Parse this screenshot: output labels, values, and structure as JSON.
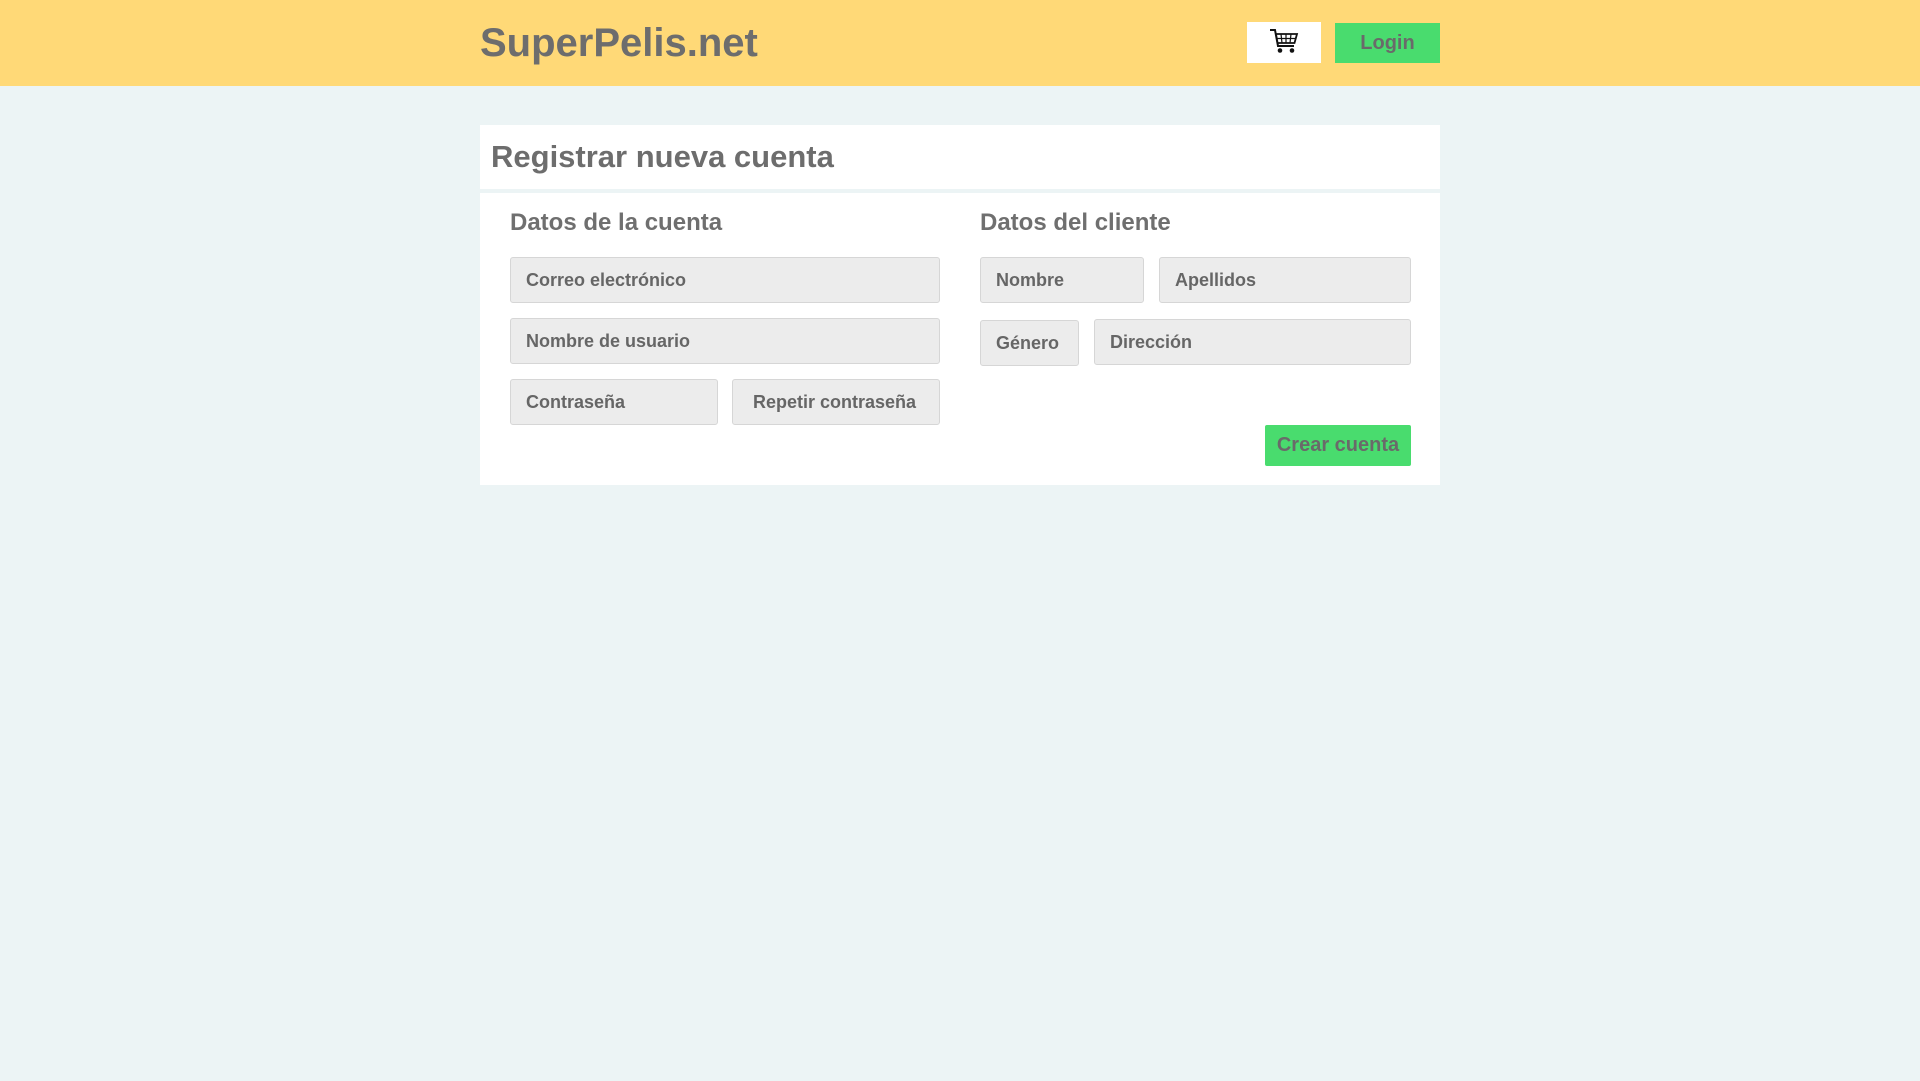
{
  "header": {
    "brand": "SuperPelis.net",
    "cart_icon": "shopping-cart-icon",
    "login_label": "Login"
  },
  "page": {
    "title": "Registrar nueva cuenta"
  },
  "account_section": {
    "title": "Datos de la cuenta",
    "email_placeholder": "Correo electrónico",
    "username_placeholder": "Nombre de usuario",
    "password_placeholder": "Contraseña",
    "repeat_password_placeholder": "Repetir contraseña"
  },
  "client_section": {
    "title": "Datos del cliente",
    "first_name_placeholder": "Nombre",
    "last_name_placeholder": "Apellidos",
    "gender_placeholder": "Género",
    "address_placeholder": "Dirección"
  },
  "actions": {
    "submit_label": "Crear cuenta"
  },
  "colors": {
    "header_bg": "#ffd977",
    "page_bg": "#ecf4f5",
    "accent_green": "#49dc6e",
    "field_bg": "#ececec"
  }
}
